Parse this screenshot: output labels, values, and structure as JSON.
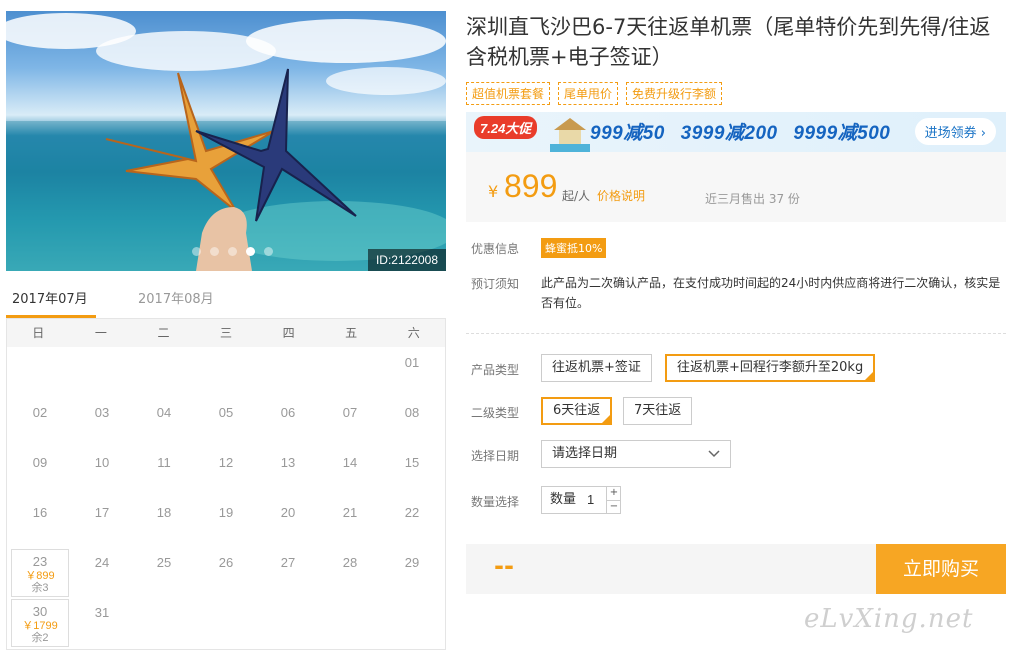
{
  "hero": {
    "image_id": "ID:2122008",
    "slide_count": 5,
    "active_slide": 4
  },
  "calendar": {
    "tabs": [
      "2017年07月",
      "2017年08月"
    ],
    "active_tab": 0,
    "weekdays": [
      "日",
      "一",
      "二",
      "三",
      "四",
      "五",
      "六"
    ],
    "days": [
      {
        "d": "01"
      },
      {
        "d": "02"
      },
      {
        "d": "03"
      },
      {
        "d": "04"
      },
      {
        "d": "05"
      },
      {
        "d": "06"
      },
      {
        "d": "07"
      },
      {
        "d": "08"
      },
      {
        "d": "09"
      },
      {
        "d": "10"
      },
      {
        "d": "11"
      },
      {
        "d": "12"
      },
      {
        "d": "13"
      },
      {
        "d": "14"
      },
      {
        "d": "15"
      },
      {
        "d": "16"
      },
      {
        "d": "17"
      },
      {
        "d": "18"
      },
      {
        "d": "19"
      },
      {
        "d": "20"
      },
      {
        "d": "21"
      },
      {
        "d": "22"
      },
      {
        "d": "23",
        "price": "￥899",
        "left": "余3"
      },
      {
        "d": "24"
      },
      {
        "d": "25"
      },
      {
        "d": "26"
      },
      {
        "d": "27"
      },
      {
        "d": "28"
      },
      {
        "d": "29"
      },
      {
        "d": "30",
        "price": "￥1799",
        "left": "余2"
      },
      {
        "d": "31"
      }
    ]
  },
  "product": {
    "title": "深圳直飞沙巴6-7天往返单机票（尾单特价先到先得/往返含税机票+电子签证）",
    "tags": [
      "超值机票套餐",
      "尾单甩价",
      "免费升级行李额"
    ]
  },
  "banner": {
    "badge": "7.24大促",
    "deals": [
      "999减50",
      "3999减200",
      "9999减500"
    ],
    "cta": "进场领券 ›"
  },
  "price": {
    "currency": "¥",
    "amount": "899",
    "unit": "起/人",
    "explain": "价格说明",
    "sold": "近三月售出 37 份"
  },
  "promo": {
    "label": "优惠信息",
    "badge": "蜂蜜抵10%"
  },
  "notice": {
    "label": "预订须知",
    "text": "此产品为二次确认产品，在支付成功时间起的24小时内供应商将进行二次确认，核实是否有位。"
  },
  "options": {
    "type_label": "产品类型",
    "types": [
      "往返机票+签证",
      "往返机票+回程行李额升至20kg"
    ],
    "selected_type": 1,
    "sub_label": "二级类型",
    "subs": [
      "6天往返",
      "7天往返"
    ],
    "selected_sub": 0,
    "date_label": "选择日期",
    "date_placeholder": "请选择日期",
    "qty_label": "数量选择",
    "qty_text": "数量",
    "qty_value": "1",
    "plus": "+",
    "minus": "−"
  },
  "buy": {
    "total": "--",
    "button": "立即购买"
  },
  "watermark": "eLvXing.net",
  "colors": {
    "accent": "#f39c12",
    "banner_blue": "#1564c0"
  }
}
